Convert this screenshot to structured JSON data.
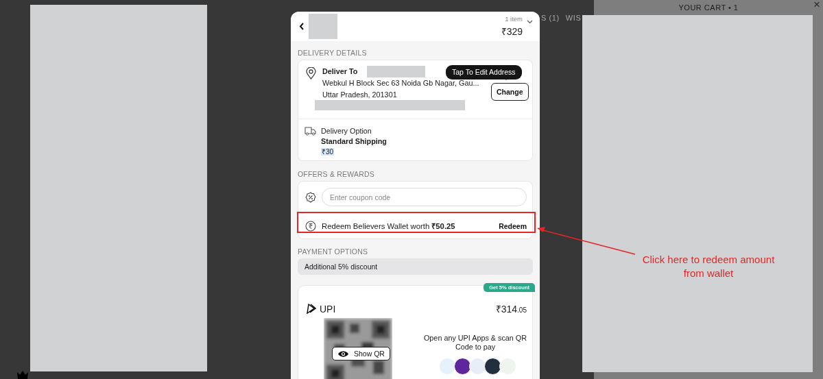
{
  "page": {
    "nav_texts": [
      "S (1)",
      "WIS"
    ]
  },
  "cart_panel": {
    "title": "YOUR CART • 1",
    "close": "×"
  },
  "checkout": {
    "header": {
      "item_count": "1 item",
      "total": "₹329"
    },
    "delivery": {
      "section_title": "DELIVERY DETAILS",
      "deliver_to": "Deliver To",
      "address_line_1": "Webkul H Block Sec 63 Noida Gb Nagar, Gau...",
      "address_line_2": "Uttar Pradesh, 201301",
      "tooltip": "Tap To Edit Address",
      "change_button": "Change",
      "option_label": "Delivery Option",
      "option_name": "Standard Shipping",
      "option_price": "₹30"
    },
    "offers": {
      "section_title": "OFFERS & REWARDS",
      "coupon_placeholder": "Enter coupon code",
      "wallet_text": "Redeem Believers Wallet worth **₹50.25**",
      "redeem_button": "Redeem"
    },
    "payment": {
      "section_title": "PAYMENT OPTIONS",
      "discount_banner": "Additional 5% discount",
      "upi": {
        "badge": "Get 5% discount",
        "name": "UPI",
        "amount_main": "₹314",
        "amount_fraction": ".05",
        "scan_text": "Open any UPI Apps & scan QR Code to pay",
        "show_qr_button": "Show QR",
        "apps": [
          {
            "color": "#e6f2fb"
          },
          {
            "color": "#5f259f"
          },
          {
            "color": "#e8eef8"
          },
          {
            "color": "#232f3e"
          },
          {
            "color": "#eef5ee"
          }
        ]
      }
    }
  },
  "annotation": {
    "text": "Click here to redeem amount from wallet"
  }
}
